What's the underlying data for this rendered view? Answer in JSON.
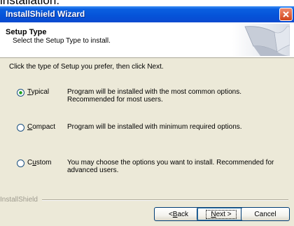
{
  "caption": "installation:",
  "window": {
    "title": "InstallShield Wizard"
  },
  "header": {
    "title": "Setup Type",
    "subtitle": "Select the Setup Type to install."
  },
  "instruction": "Click the type of Setup you prefer, then click Next.",
  "options": [
    {
      "label_first": "T",
      "label_rest": "ypical",
      "selected": true,
      "description": "Program will be installed with the most common options.  Recommended for most users."
    },
    {
      "label_first": "C",
      "label_rest": "ompact",
      "selected": false,
      "description": "Program will be installed with minimum required options."
    },
    {
      "label_first": "C",
      "label_pre": "",
      "label_rest": "ustom",
      "selected": false,
      "description": "You may choose the options you want to install. Recommended for advanced users."
    }
  ],
  "brand": "InstallShield",
  "buttons": {
    "back": {
      "pre": "< ",
      "u": "B",
      "rest": "ack"
    },
    "next": {
      "u": "N",
      "rest": "ext >"
    },
    "cancel": "Cancel"
  }
}
